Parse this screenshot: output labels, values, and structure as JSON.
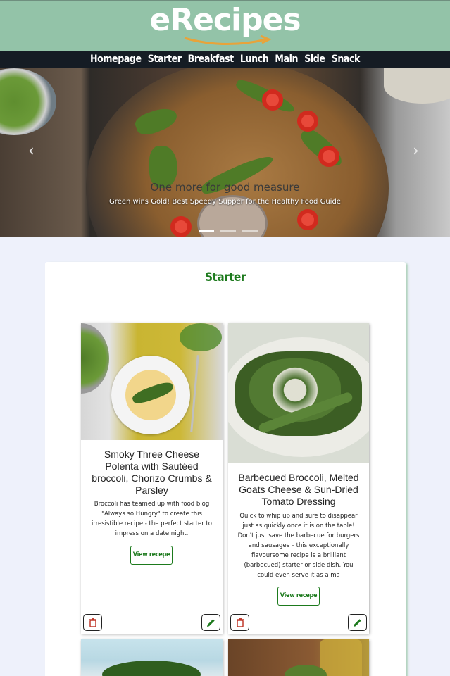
{
  "brand": {
    "logo_text": "eRecipes"
  },
  "nav": {
    "items": [
      "Homepage",
      "Starter",
      "Breakfast",
      "Lunch",
      "Main",
      "Side",
      "Snack"
    ]
  },
  "carousel": {
    "title": "One more for good measure",
    "subtitle": "Green wins Gold! Best Speedy Supper for the Healthy Food Guide",
    "indicator_count": 3,
    "active_index": 0,
    "prev_icon": "chevron-left-icon",
    "next_icon": "chevron-right-icon"
  },
  "section": {
    "title": "Starter"
  },
  "cards": [
    {
      "title": "Smoky Three Cheese Polenta with Sautéed broccoli, Chorizo Crumbs & Parsley",
      "description": "Broccoli has teamed up with food blog \"Always so Hungry\" to create this irresistible recipe - the perfect starter to impress on a date night.",
      "button_label": "View recepe",
      "delete_icon": "trash-icon",
      "edit_icon": "pencil-icon"
    },
    {
      "title": "Barbecued Broccoli, Melted Goats Cheese & Sun-Dried Tomato Dressing",
      "description": "Quick to whip up and sure to disappear just as quickly once it is on the table! Don't just save the barbecue for burgers and sausages – this exceptionally flavoursome recipe is a brilliant (barbecued) starter or side dish. You could even serve it as a ma",
      "button_label": "View recepe",
      "delete_icon": "trash-icon",
      "edit_icon": "pencil-icon"
    }
  ],
  "colors": {
    "header_bg": "#93c3a8",
    "nav_bg": "#151c24",
    "accent_green": "#1d7a1d",
    "delete_red": "#c0392b",
    "edit_green": "#1d7a1d",
    "page_bg": "#eef1fb"
  }
}
